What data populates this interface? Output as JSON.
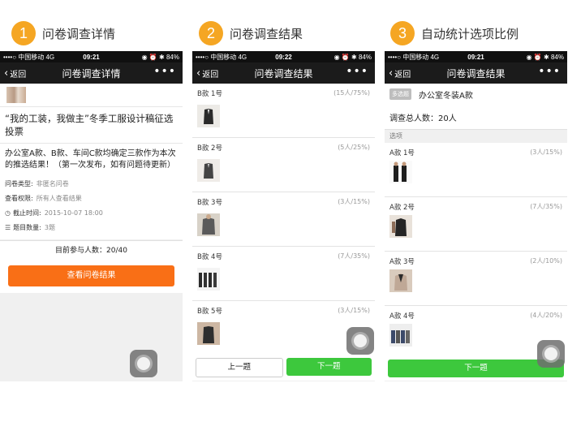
{
  "steps": [
    {
      "num": "1",
      "title": "问卷调查详情"
    },
    {
      "num": "2",
      "title": "问卷调查结果"
    },
    {
      "num": "3",
      "title": "自动统计选项比例"
    }
  ],
  "statusbar": [
    {
      "carrier": "••••○ 中国移动  4G",
      "time": "09:21",
      "right": "◉ ⏰ ✱ 84%"
    },
    {
      "carrier": "••••○ 中国移动  4G",
      "time": "09:22",
      "right": "◉ ⏰ ✱ 84%"
    },
    {
      "carrier": "••••○ 中国移动  4G",
      "time": "09:21",
      "right": "◉ ⏰ ✱ 84%"
    }
  ],
  "nav": {
    "back": "返回",
    "more": "•••",
    "titles": [
      "问卷调查详情",
      "问卷调查结果",
      "问卷调查结果"
    ]
  },
  "detail": {
    "heading": "“我的工装，我做主”冬季工服设计稿征选投票",
    "description": "办公室A款、B款、车间C款均确定三款作为本次的推选结果！（第一次发布，如有问题待更新）",
    "meta": [
      {
        "key": "问卷类型:",
        "value": "非匿名问卷"
      },
      {
        "key": "查看权限:",
        "value": "所有人查看结果"
      },
      {
        "key": "截止时间:",
        "value": "2015-10-07 18:00"
      },
      {
        "key": "题目数量:",
        "value": "3题"
      }
    ],
    "participants": "目前参与人数：20/40",
    "view_button": "查看问卷结果"
  },
  "results": {
    "items": [
      {
        "label": "B款 1号",
        "stat": "(15人/75%)"
      },
      {
        "label": "B款 2号",
        "stat": "(5人/25%)"
      },
      {
        "label": "B款 3号",
        "stat": "(3人/15%)"
      },
      {
        "label": "B款 4号",
        "stat": "(7人/35%)"
      },
      {
        "label": "B款 5号",
        "stat": "(3人/15%)"
      }
    ],
    "prev_button": "上一题",
    "next_button": "下一题"
  },
  "stats": {
    "badge": "多选题",
    "title": "办公室冬装A款",
    "total": "调查总人数：20人",
    "section": "选项",
    "items": [
      {
        "label": "A款 1号",
        "stat": "(3人/15%)"
      },
      {
        "label": "A款 2号",
        "stat": "(7人/35%)"
      },
      {
        "label": "A款 3号",
        "stat": "(2人/10%)"
      },
      {
        "label": "A款 4号",
        "stat": "(4人/20%)"
      }
    ],
    "next_button": "下一题"
  },
  "colors": {
    "accent": "#f5a623",
    "orange_button": "#f96f16",
    "green_button": "#3dc83d",
    "navbar": "#1b1b1b"
  }
}
